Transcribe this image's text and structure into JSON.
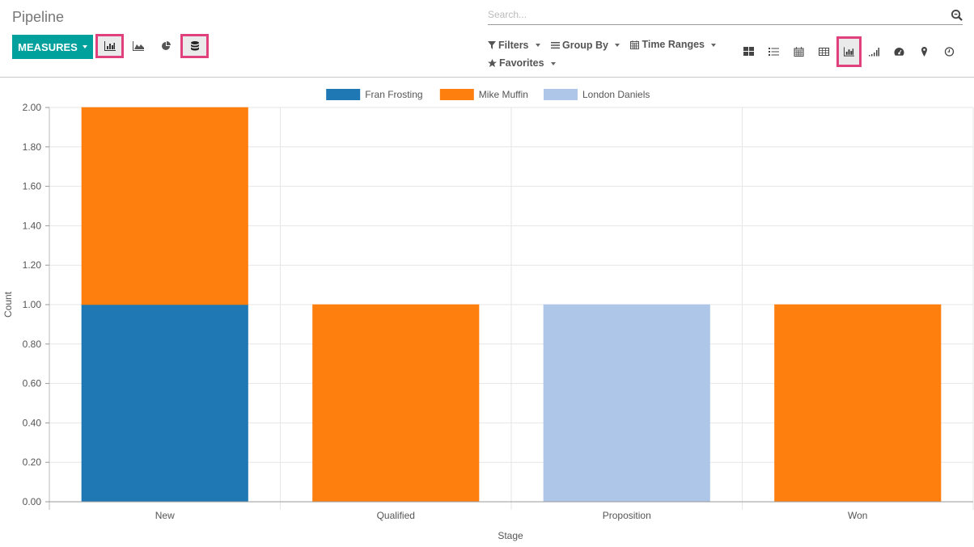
{
  "header": {
    "title": "Pipeline",
    "measures_label": "MEASURES",
    "search_placeholder": "Search...",
    "filters": [
      {
        "icon": "filter-icon",
        "label": "Filters"
      },
      {
        "icon": "bars-icon",
        "label": "Group By"
      },
      {
        "icon": "calendar-icon",
        "label": "Time Ranges"
      },
      {
        "icon": "star-icon",
        "label": "Favorites"
      }
    ],
    "chart_type_buttons": [
      {
        "icon": "bar-chart-icon",
        "active": true
      },
      {
        "icon": "area-chart-icon",
        "active": false
      },
      {
        "icon": "pie-chart-icon",
        "active": false
      },
      {
        "icon": "database-stack-icon",
        "active": true
      }
    ],
    "view_buttons": [
      {
        "icon": "kanban-icon",
        "active": false
      },
      {
        "icon": "list-icon",
        "active": false
      },
      {
        "icon": "calendar-icon",
        "active": false
      },
      {
        "icon": "pivot-table-icon",
        "active": false
      },
      {
        "icon": "graph-icon",
        "active": true
      },
      {
        "icon": "cohort-icon",
        "active": false
      },
      {
        "icon": "dashboard-icon",
        "active": false
      },
      {
        "icon": "map-marker-icon",
        "active": false
      },
      {
        "icon": "activity-clock-icon",
        "active": false
      }
    ]
  },
  "chart_data": {
    "type": "bar",
    "stacked": true,
    "title": "",
    "xlabel": "Stage",
    "ylabel": "Count",
    "ylim": [
      0,
      2
    ],
    "yticks": [
      "0.00",
      "0.20",
      "0.40",
      "0.60",
      "0.80",
      "1.00",
      "1.20",
      "1.40",
      "1.60",
      "1.80",
      "2.00"
    ],
    "grid": true,
    "legend_position": "top-center",
    "categories": [
      "New",
      "Qualified",
      "Proposition",
      "Won"
    ],
    "series": [
      {
        "name": "Fran Frosting",
        "color": "#1f77b4",
        "values": [
          1,
          0,
          0,
          0
        ]
      },
      {
        "name": "Mike Muffin",
        "color": "#ff7f0e",
        "values": [
          1,
          1,
          0,
          1
        ]
      },
      {
        "name": "London Daniels",
        "color": "#aec7e8",
        "values": [
          0,
          0,
          1,
          0
        ]
      }
    ]
  }
}
